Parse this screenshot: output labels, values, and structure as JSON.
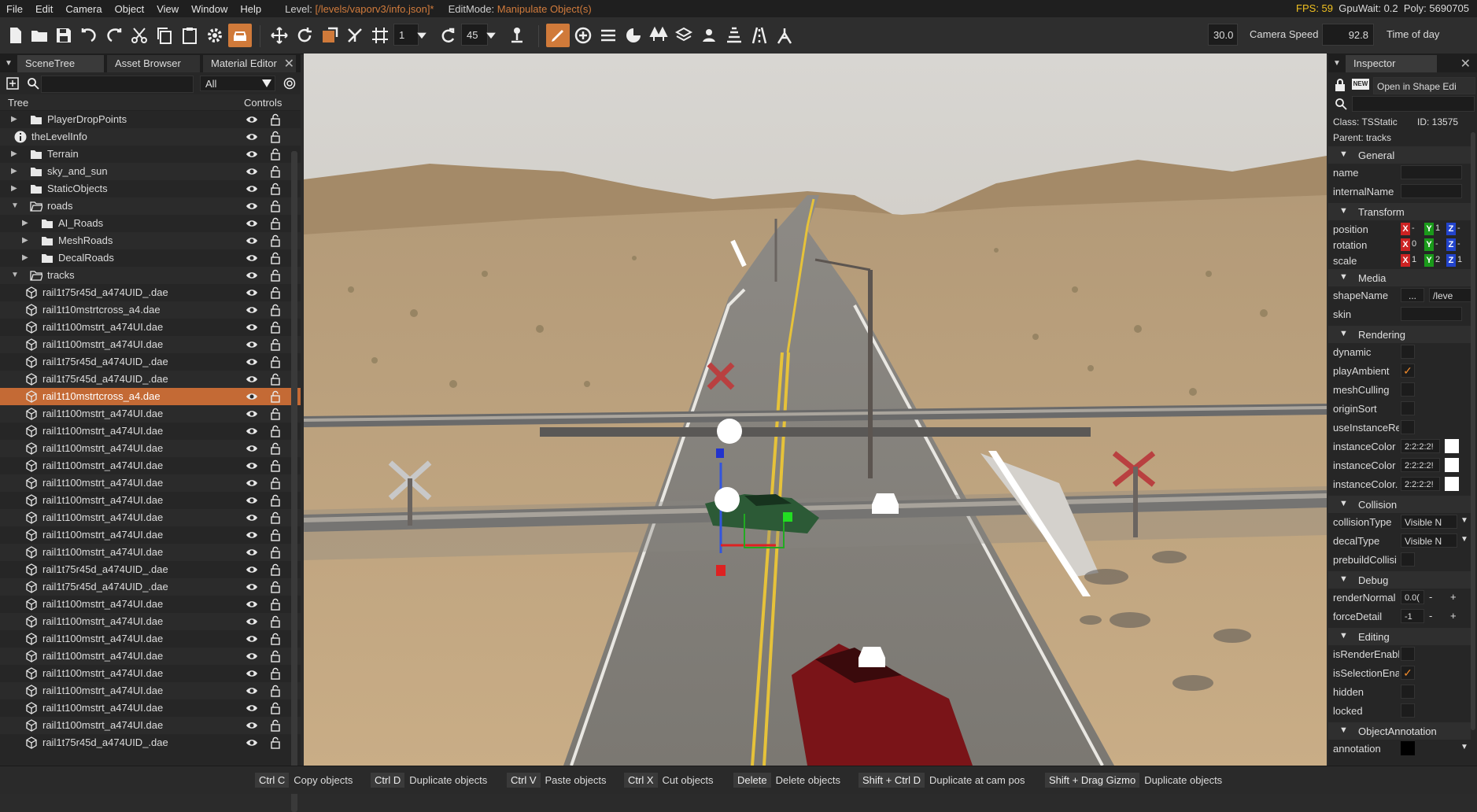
{
  "menubar": {
    "items": [
      "File",
      "Edit",
      "Camera",
      "Object",
      "View",
      "Window",
      "Help"
    ],
    "level_label": "Level:",
    "level_value": "[/levels/vaporv3/info.json]*",
    "editmode_label": "EditMode:",
    "editmode_value": "Manipulate Object(s)",
    "fps_label": "FPS: 59",
    "gpuwait": "GpuWait: 0.2",
    "poly": "Poly: 5690705"
  },
  "toolbar": {
    "grid_value": "1",
    "rotate_snap_value": "45",
    "camera_speed_value": "30.0",
    "camera_speed_label": "Camera Speed",
    "time_value": "92.8",
    "time_label": "Time of day"
  },
  "left_panel": {
    "tabs": [
      "SceneTree",
      "Asset Browser",
      "Material Editor"
    ],
    "filter_value": "All",
    "header_tree": "Tree",
    "header_controls": "Controls",
    "rows": [
      {
        "label": "PlayerDropPoints",
        "type": "folder",
        "depth": 0,
        "expander": "closed"
      },
      {
        "label": "theLevelInfo",
        "type": "info",
        "depth": 0,
        "expander": "none"
      },
      {
        "label": "Terrain",
        "type": "folder",
        "depth": 0,
        "expander": "closed"
      },
      {
        "label": "sky_and_sun",
        "type": "folder",
        "depth": 0,
        "expander": "closed"
      },
      {
        "label": "StaticObjects",
        "type": "folder",
        "depth": 0,
        "expander": "closed"
      },
      {
        "label": "roads",
        "type": "folder-open",
        "depth": 0,
        "expander": "open"
      },
      {
        "label": "AI_Roads",
        "type": "folder",
        "depth": 1,
        "expander": "closed"
      },
      {
        "label": "MeshRoads",
        "type": "folder",
        "depth": 1,
        "expander": "closed"
      },
      {
        "label": "DecalRoads",
        "type": "folder",
        "depth": 1,
        "expander": "closed"
      },
      {
        "label": "tracks",
        "type": "folder-open",
        "depth": 0,
        "expander": "open"
      },
      {
        "label": "rail1t75r45d_a474UID_.dae",
        "type": "mesh",
        "depth": 1,
        "expander": "none"
      },
      {
        "label": "rail1t10mstrtcross_a4.dae",
        "type": "mesh",
        "depth": 1,
        "expander": "none"
      },
      {
        "label": "rail1t100mstrt_a474UI.dae",
        "type": "mesh",
        "depth": 1,
        "expander": "none"
      },
      {
        "label": "rail1t100mstrt_a474UI.dae",
        "type": "mesh",
        "depth": 1,
        "expander": "none"
      },
      {
        "label": "rail1t75r45d_a474UID_.dae",
        "type": "mesh",
        "depth": 1,
        "expander": "none"
      },
      {
        "label": "rail1t75r45d_a474UID_.dae",
        "type": "mesh",
        "depth": 1,
        "expander": "none"
      },
      {
        "label": "rail1t10mstrtcross_a4.dae",
        "type": "mesh",
        "depth": 1,
        "expander": "none",
        "selected": true
      },
      {
        "label": "rail1t100mstrt_a474UI.dae",
        "type": "mesh",
        "depth": 1,
        "expander": "none"
      },
      {
        "label": "rail1t100mstrt_a474UI.dae",
        "type": "mesh",
        "depth": 1,
        "expander": "none"
      },
      {
        "label": "rail1t100mstrt_a474UI.dae",
        "type": "mesh",
        "depth": 1,
        "expander": "none"
      },
      {
        "label": "rail1t100mstrt_a474UI.dae",
        "type": "mesh",
        "depth": 1,
        "expander": "none"
      },
      {
        "label": "rail1t100mstrt_a474UI.dae",
        "type": "mesh",
        "depth": 1,
        "expander": "none"
      },
      {
        "label": "rail1t100mstrt_a474UI.dae",
        "type": "mesh",
        "depth": 1,
        "expander": "none"
      },
      {
        "label": "rail1t100mstrt_a474UI.dae",
        "type": "mesh",
        "depth": 1,
        "expander": "none"
      },
      {
        "label": "rail1t100mstrt_a474UI.dae",
        "type": "mesh",
        "depth": 1,
        "expander": "none"
      },
      {
        "label": "rail1t100mstrt_a474UI.dae",
        "type": "mesh",
        "depth": 1,
        "expander": "none"
      },
      {
        "label": "rail1t75r45d_a474UID_.dae",
        "type": "mesh",
        "depth": 1,
        "expander": "none"
      },
      {
        "label": "rail1t75r45d_a474UID_.dae",
        "type": "mesh",
        "depth": 1,
        "expander": "none"
      },
      {
        "label": "rail1t100mstrt_a474UI.dae",
        "type": "mesh",
        "depth": 1,
        "expander": "none"
      },
      {
        "label": "rail1t100mstrt_a474UI.dae",
        "type": "mesh",
        "depth": 1,
        "expander": "none"
      },
      {
        "label": "rail1t100mstrt_a474UI.dae",
        "type": "mesh",
        "depth": 1,
        "expander": "none"
      },
      {
        "label": "rail1t100mstrt_a474UI.dae",
        "type": "mesh",
        "depth": 1,
        "expander": "none"
      },
      {
        "label": "rail1t100mstrt_a474UI.dae",
        "type": "mesh",
        "depth": 1,
        "expander": "none"
      },
      {
        "label": "rail1t100mstrt_a474UI.dae",
        "type": "mesh",
        "depth": 1,
        "expander": "none"
      },
      {
        "label": "rail1t100mstrt_a474UI.dae",
        "type": "mesh",
        "depth": 1,
        "expander": "none"
      },
      {
        "label": "rail1t100mstrt_a474UI.dae",
        "type": "mesh",
        "depth": 1,
        "expander": "none"
      },
      {
        "label": "rail1t75r45d_a474UID_.dae",
        "type": "mesh",
        "depth": 1,
        "expander": "none"
      }
    ]
  },
  "inspector": {
    "title": "Inspector",
    "open_shape_label": "Open in Shape Edi",
    "class_text": "Class: TSStatic",
    "id_text": "ID: 13575",
    "parent_text": "Parent: tracks",
    "sections": {
      "general": "General",
      "transform": "Transform",
      "media": "Media",
      "rendering": "Rendering",
      "collision": "Collision",
      "debug": "Debug",
      "editing": "Editing",
      "annotation": "ObjectAnnotation"
    },
    "fields": {
      "name": "name",
      "internalName": "internalName",
      "position": "position",
      "rotation": "rotation",
      "scale": "scale",
      "shapeName": "shapeName",
      "shapeName_btn": "...",
      "shapeName_value": "/leve",
      "skin": "skin",
      "dynamic": "dynamic",
      "playAmbient": "playAmbient",
      "meshCulling": "meshCulling",
      "originSort": "originSort",
      "useInstanceRe": "useInstanceRe",
      "instanceColor1": "instanceColor",
      "instanceColor2": "instanceColor",
      "instanceColor3": "instanceColor.",
      "instanceColor_values": "2:2:2:2!",
      "instanceColor_values2": "2:2:2:2!",
      "collisionType": "collisionType",
      "collisionType_value": "Visible N",
      "decalType": "decalType",
      "decalType_value": "Visible N",
      "prebuildCollisi": "prebuildCollisi",
      "renderNormal": "renderNormal",
      "renderNormal_value": "0.0(",
      "forceDetail": "forceDetail",
      "forceDetail_value": "-1",
      "isRenderEnabl": "isRenderEnabl",
      "isSelectionEna": "isSelectionEna",
      "hidden": "hidden",
      "locked": "locked",
      "annotation": "annotation"
    },
    "xyz": {
      "position": [
        "-",
        "1",
        "-"
      ],
      "rotation": [
        "0",
        "-",
        "-"
      ],
      "scale": [
        "1",
        "2",
        "1"
      ]
    }
  },
  "statusbar": [
    {
      "key": "Ctrl C",
      "action": "Copy objects"
    },
    {
      "key": "Ctrl D",
      "action": "Duplicate objects"
    },
    {
      "key": "Ctrl V",
      "action": "Paste objects"
    },
    {
      "key": "Ctrl X",
      "action": "Cut objects"
    },
    {
      "key": "Delete",
      "action": "Delete objects"
    },
    {
      "key": "Shift + Ctrl D",
      "action": "Duplicate at cam pos"
    },
    {
      "key": "Shift + Drag Gizmo",
      "action": "Duplicate objects"
    }
  ],
  "colors": {
    "accent": "#d07a3a",
    "selected_row": "#c46a35",
    "fps": "#f0c020"
  }
}
